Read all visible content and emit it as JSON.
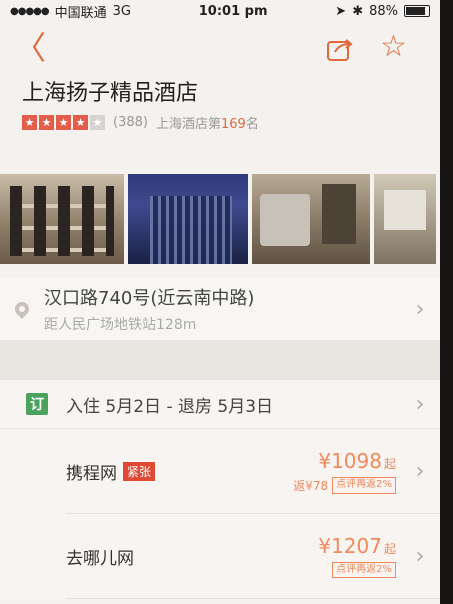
{
  "status_bar": {
    "carrier": "中国联通",
    "network": "3G",
    "time": "10:01 pm",
    "battery": "88%"
  },
  "nav": {
    "back_icon": "chevron-left-icon",
    "share_icon": "share-icon",
    "favorite_icon": "star-outline-icon"
  },
  "hotel": {
    "name": "上海扬子精品酒店",
    "rating_stars": 4,
    "reviews": "(388)",
    "rank_prefix": "上海酒店第",
    "rank_number": "169",
    "rank_suffix": "名"
  },
  "address": {
    "main": "汉口路740号(近云南中路)",
    "sub": "距人民广场地铁站128m"
  },
  "booking": {
    "icon_label": "订",
    "dates": "入住 5月2日 - 退房 5月3日",
    "vendors": [
      {
        "name": "携程网",
        "tag": "紧张",
        "price": "¥1098",
        "price_suffix": "起",
        "rebate": "返¥78",
        "badge": "点评再返2%"
      },
      {
        "name": "去哪儿网",
        "tag": "",
        "price": "¥1207",
        "price_suffix": "起",
        "rebate": "",
        "badge": "点评再返2%"
      }
    ]
  },
  "colors": {
    "accent": "#e06a3c",
    "price": "#f08a5d",
    "urgent_tag": "#e04a34",
    "booking_icon": "#4aa35c"
  }
}
